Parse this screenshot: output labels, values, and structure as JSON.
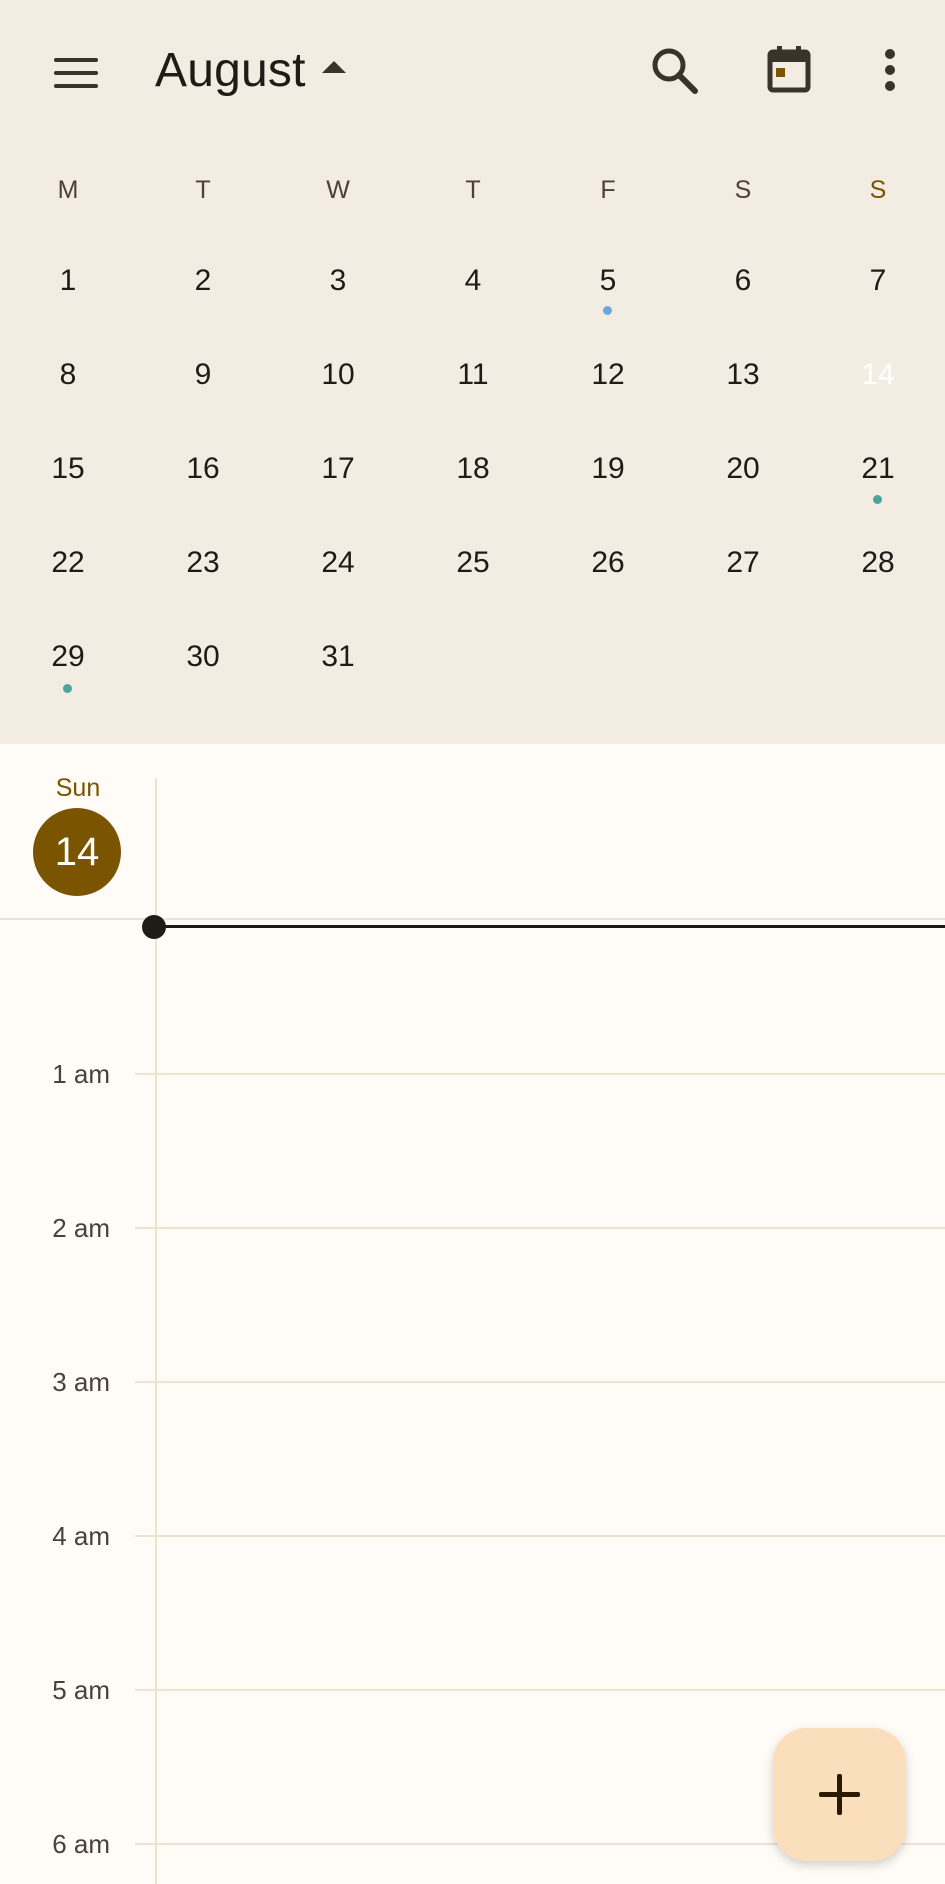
{
  "app_bar": {
    "month": "August",
    "icons": [
      "menu-icon",
      "caret-up-icon",
      "search-icon",
      "today-calendar-icon",
      "more-vert-icon"
    ]
  },
  "weekdays": [
    "M",
    "T",
    "W",
    "T",
    "F",
    "S",
    "S"
  ],
  "month_grid": {
    "weeks": [
      [
        "1",
        "2",
        "3",
        "4",
        "5",
        "6",
        "7"
      ],
      [
        "8",
        "9",
        "10",
        "11",
        "12",
        "13",
        "14"
      ],
      [
        "15",
        "16",
        "17",
        "18",
        "19",
        "20",
        "21"
      ],
      [
        "22",
        "23",
        "24",
        "25",
        "26",
        "27",
        "28"
      ],
      [
        "29",
        "30",
        "31",
        "",
        "",
        "",
        ""
      ]
    ],
    "today": "14",
    "event_dots": [
      {
        "day": "5",
        "color": "#6ea8d9"
      },
      {
        "day": "21",
        "color": "#4aa69b"
      },
      {
        "day": "29",
        "color": "#4aa69b"
      }
    ]
  },
  "day_view": {
    "day_name": "Sun",
    "day_number": "14",
    "hours": [
      "1 am",
      "2 am",
      "3 am",
      "4 am",
      "5 am",
      "6 am"
    ]
  },
  "colors": {
    "accent": "#7b5400",
    "header_bg": "#f2ece2",
    "body_bg": "#fffbf6",
    "fab_bg": "#fbdfbd"
  },
  "fab": {
    "icon": "plus-icon"
  }
}
